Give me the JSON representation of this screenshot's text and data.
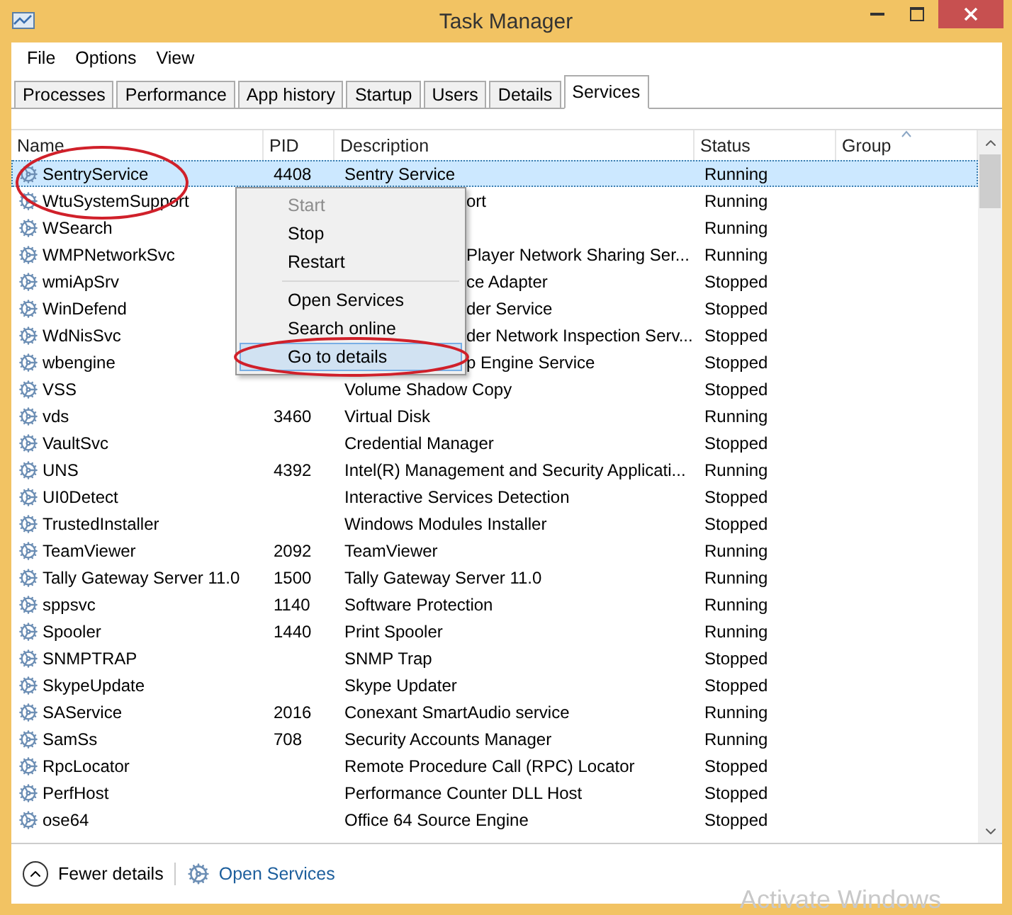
{
  "window": {
    "title": "Task Manager"
  },
  "menu_bar": [
    "File",
    "Options",
    "View"
  ],
  "tabs": [
    {
      "label": "Processes",
      "selected": false
    },
    {
      "label": "Performance",
      "selected": false
    },
    {
      "label": "App history",
      "selected": false
    },
    {
      "label": "Startup",
      "selected": false
    },
    {
      "label": "Users",
      "selected": false
    },
    {
      "label": "Details",
      "selected": false
    },
    {
      "label": "Services",
      "selected": true
    }
  ],
  "table": {
    "columns": [
      {
        "label": "Name",
        "sorted": false
      },
      {
        "label": "PID",
        "sorted": false
      },
      {
        "label": "Description",
        "sorted": false
      },
      {
        "label": "Status",
        "sorted": false
      },
      {
        "label": "Group",
        "sorted": true
      }
    ],
    "rows": [
      {
        "name": "SentryService",
        "pid": "4408",
        "description": "Sentry Service",
        "status": "Running",
        "selected": true
      },
      {
        "name": "WtuSystemSupport",
        "description": "ort",
        "status": "Running",
        "selected": false
      },
      {
        "name": "WSearch",
        "status": "Running",
        "selected": false
      },
      {
        "name": "WMPNetworkSvc",
        "description": "Player Network Sharing Ser...",
        "status": "Running",
        "selected": false
      },
      {
        "name": "wmiApSrv",
        "description": "ce Adapter",
        "status": "Stopped",
        "selected": false
      },
      {
        "name": "WinDefend",
        "description": "der Service",
        "status": "Stopped",
        "selected": false
      },
      {
        "name": "WdNisSvc",
        "description": "der Network Inspection Serv...",
        "status": "Stopped",
        "selected": false
      },
      {
        "name": "wbengine",
        "description": "p Engine Service",
        "status": "Stopped",
        "selected": false
      },
      {
        "name": "VSS",
        "description": "Volume Shadow Copy",
        "status": "Stopped",
        "selected": false
      },
      {
        "name": "vds",
        "pid": "3460",
        "description": "Virtual Disk",
        "status": "Running",
        "selected": false
      },
      {
        "name": "VaultSvc",
        "description": "Credential Manager",
        "status": "Stopped",
        "selected": false
      },
      {
        "name": "UNS",
        "pid": "4392",
        "description": "Intel(R) Management and Security Applicati...",
        "status": "Running",
        "selected": false
      },
      {
        "name": "UI0Detect",
        "description": "Interactive Services Detection",
        "status": "Stopped",
        "selected": false
      },
      {
        "name": "TrustedInstaller",
        "description": "Windows Modules Installer",
        "status": "Stopped",
        "selected": false
      },
      {
        "name": "TeamViewer",
        "pid": "2092",
        "description": "TeamViewer",
        "status": "Running",
        "selected": false
      },
      {
        "name": "Tally Gateway Server 11.0",
        "pid": "1500",
        "description": "Tally Gateway Server 11.0",
        "status": "Running",
        "selected": false
      },
      {
        "name": "sppsvc",
        "pid": "1140",
        "description": "Software Protection",
        "status": "Running",
        "selected": false
      },
      {
        "name": "Spooler",
        "pid": "1440",
        "description": "Print Spooler",
        "status": "Running",
        "selected": false
      },
      {
        "name": "SNMPTRAP",
        "description": "SNMP Trap",
        "status": "Stopped",
        "selected": false
      },
      {
        "name": "SkypeUpdate",
        "description": "Skype Updater",
        "status": "Stopped",
        "selected": false
      },
      {
        "name": "SAService",
        "pid": "2016",
        "description": "Conexant SmartAudio service",
        "status": "Running",
        "selected": false
      },
      {
        "name": "SamSs",
        "pid": "708",
        "description": "Security Accounts Manager",
        "status": "Running",
        "selected": false
      },
      {
        "name": "RpcLocator",
        "description": "Remote Procedure Call (RPC) Locator",
        "status": "Stopped",
        "selected": false
      },
      {
        "name": "PerfHost",
        "description": "Performance Counter DLL Host",
        "status": "Stopped",
        "selected": false
      },
      {
        "name": "ose64",
        "description": "Office 64 Source Engine",
        "status": "Stopped",
        "selected": false
      }
    ]
  },
  "context_menu": [
    {
      "kind": "item",
      "label": "Start",
      "disabled": true,
      "selected": false
    },
    {
      "kind": "item",
      "label": "Stop",
      "disabled": false,
      "selected": false
    },
    {
      "kind": "item",
      "label": "Restart",
      "disabled": false,
      "selected": false
    },
    {
      "kind": "separator"
    },
    {
      "kind": "item",
      "label": "Open Services",
      "disabled": false,
      "selected": false
    },
    {
      "kind": "item",
      "label": "Search online",
      "disabled": false,
      "selected": false
    },
    {
      "kind": "item",
      "label": "Go to details",
      "disabled": false,
      "selected": true
    }
  ],
  "footer": {
    "toggle": "Fewer details",
    "link": "Open Services"
  },
  "os_notice": "Activate Windows"
}
